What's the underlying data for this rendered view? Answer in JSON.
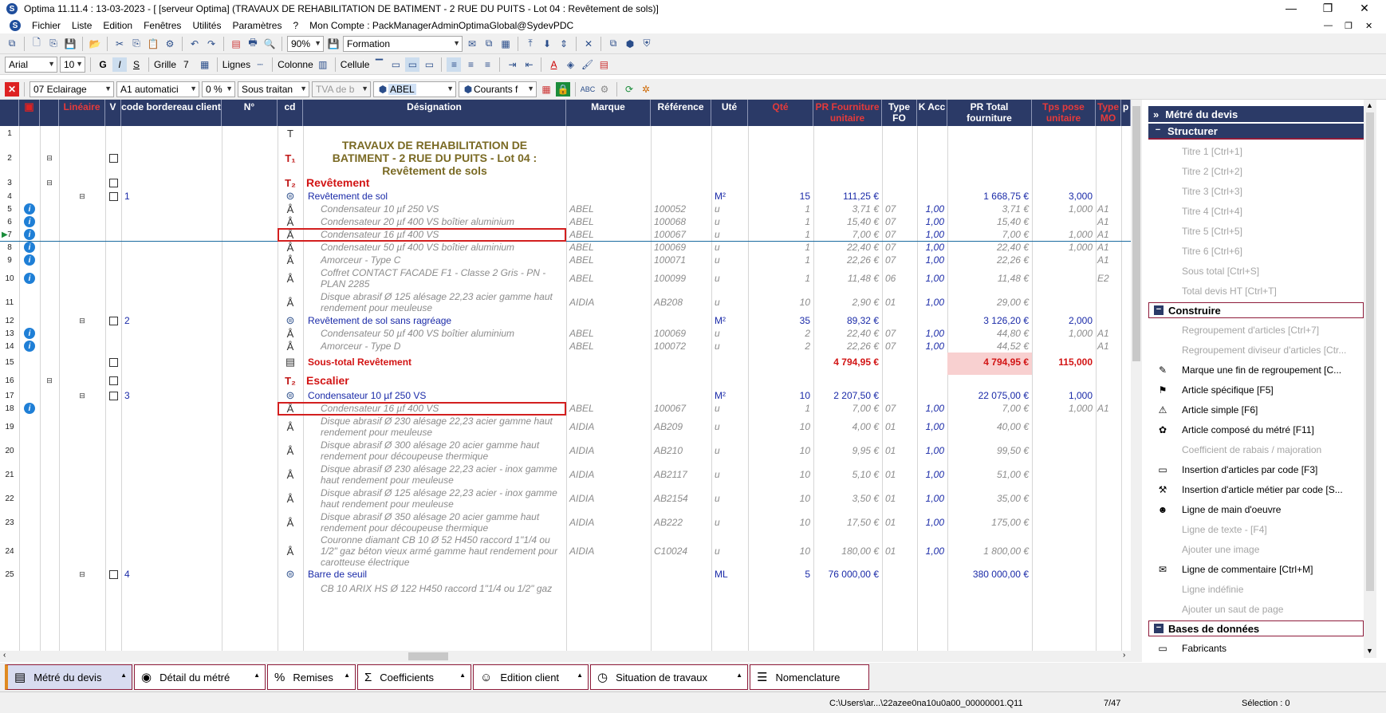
{
  "window": {
    "title": "Optima 11.11.4 : 13-03-2023 - [ [serveur Optima] (TRAVAUX DE REHABILITATION DE BATIMENT - 2 RUE DU PUITS - Lot 04 : Revêtement de sols)]",
    "minimize": "—",
    "restore": "❐",
    "close": "✕"
  },
  "menu": [
    "Fichier",
    "Liste",
    "Edition",
    "Fenêtres",
    "Utilités",
    "Paramètres",
    "?",
    "Mon Compte : PackManagerAdminOptimaGlobal@SydevPDC"
  ],
  "menu_right": [
    "—",
    "❐",
    "✕"
  ],
  "toolbar1": {
    "zoom": "90%",
    "formation": "Formation"
  },
  "toolbar2": {
    "font": "Arial",
    "size": "10",
    "bold": "G",
    "italic": "I",
    "strike": "S",
    "grille": "Grille",
    "grille_val": "7",
    "lignes": "Lignes",
    "colonne": "Colonne",
    "cellule": "Cellule"
  },
  "toolbar3": {
    "lot": "07  Eclairage",
    "mode": "A1  automatici",
    "pct": "0 %",
    "sous": "Sous traitan",
    "tva": "TVA de b",
    "fab": "ABEL",
    "cours": "Courants f"
  },
  "headers": [
    "",
    "",
    "Linéaire",
    "V",
    "code bordereau client",
    "N°",
    "cd",
    "Désignation",
    "Marque",
    "Référence",
    "Uté",
    "Qté",
    "PR Fourniture unitaire",
    "Type FO",
    "K Acc",
    "PR Total fourniture",
    "Tps pose unitaire",
    "Type MO",
    "p"
  ],
  "rows": [
    {
      "n": "1",
      "cd": "T",
      "des": "",
      "style": "plain"
    },
    {
      "n": "2",
      "cd": "T1",
      "des": "TRAVAUX DE REHABILITATION DE BATIMENT - 2 RUE DU PUITS  - Lot 04 : Revêtement de sols",
      "style": "bigtitle",
      "chk": true,
      "tree": "⊟"
    },
    {
      "n": "3",
      "cd": "T2",
      "des": "Revêtement",
      "style": "title",
      "chk": true,
      "tree": "⊟"
    },
    {
      "n": "4",
      "num": "1",
      "cd": "C",
      "des": "Revêtement de sol",
      "style": "comp",
      "ute": "M²",
      "qte": "15",
      "pru": "111,25 €",
      "prt": "1 668,75 €",
      "tps": "3,000",
      "chk": true,
      "tree": "⊟"
    },
    {
      "n": "5",
      "cd": "A",
      "des": "Condensateur 10 µf 250 VS",
      "style": "sub",
      "info": true,
      "marque": "ABEL",
      "ref": "100052",
      "ute": "u",
      "qte": "1",
      "pru": "3,71 €",
      "tfo": "07",
      "kacc": "1,00",
      "prt": "3,71 €",
      "tps": "1,000",
      "tmo": "A1"
    },
    {
      "n": "6",
      "cd": "A",
      "des": "Condensateur 20 µf 400 VS boîtier aluminium",
      "style": "sub",
      "info": true,
      "marque": "ABEL",
      "ref": "100068",
      "ute": "u",
      "qte": "1",
      "pru": "15,40 €",
      "tfo": "07",
      "kacc": "1,00",
      "prt": "15,40 €",
      "tps": "",
      "tmo": "A1"
    },
    {
      "n": "7",
      "cd": "A",
      "des": "Condensateur 16 µf 400 VS",
      "style": "sub",
      "info": true,
      "cur": true,
      "hl": true,
      "marque": "ABEL",
      "ref": "100067",
      "ute": "u",
      "qte": "1",
      "pru": "7,00 €",
      "tfo": "07",
      "kacc": "1,00",
      "prt": "7,00 €",
      "tps": "1,000",
      "tmo": "A1"
    },
    {
      "n": "8",
      "cd": "A",
      "des": "Condensateur 50 µf 400 VS boîtier aluminium",
      "style": "sub",
      "info": true,
      "marque": "ABEL",
      "ref": "100069",
      "ute": "u",
      "qte": "1",
      "pru": "22,40 €",
      "tfo": "07",
      "kacc": "1,00",
      "prt": "22,40 €",
      "tps": "1,000",
      "tmo": "A1"
    },
    {
      "n": "9",
      "cd": "A",
      "des": "Amorceur  - Type C",
      "style": "sub",
      "info": true,
      "marque": "ABEL",
      "ref": "100071",
      "ute": "u",
      "qte": "1",
      "pru": "22,26 €",
      "tfo": "07",
      "kacc": "1,00",
      "prt": "22,26 €",
      "tps": "",
      "tmo": "A1"
    },
    {
      "n": "10",
      "cd": "A",
      "des": "Coffret CONTACT FACADE F1 - Classe 2 Gris - PN - PLAN 2285",
      "style": "sub",
      "info": true,
      "marque": "ABEL",
      "ref": "100099",
      "ute": "u",
      "qte": "1",
      "pru": "11,48 €",
      "tfo": "06",
      "kacc": "1,00",
      "prt": "11,48 €",
      "tps": "",
      "tmo": "E2"
    },
    {
      "n": "11",
      "cd": "A",
      "des": "Disque abrasif Ø 125 alésage 22,23 acier gamme haut rendement pour meuleuse",
      "style": "sub",
      "marque": "AIDIA",
      "ref": "AB208",
      "ute": "u",
      "qte": "10",
      "pru": "2,90 €",
      "tfo": "01",
      "kacc": "1,00",
      "prt": "29,00 €",
      "tps": "",
      "tmo": ""
    },
    {
      "n": "12",
      "num": "2",
      "cd": "C",
      "des": "Revêtement de sol sans ragréage",
      "style": "comp",
      "ute": "M²",
      "qte": "35",
      "pru": "89,32 €",
      "prt": "3 126,20 €",
      "tps": "2,000",
      "chk": true,
      "tree": "⊟"
    },
    {
      "n": "13",
      "cd": "A",
      "des": "Condensateur 50 µf 400 VS boîtier aluminium",
      "style": "sub",
      "info": true,
      "marque": "ABEL",
      "ref": "100069",
      "ute": "u",
      "qte": "2",
      "pru": "22,40 €",
      "tfo": "07",
      "kacc": "1,00",
      "prt": "44,80 €",
      "tps": "1,000",
      "tmo": "A1"
    },
    {
      "n": "14",
      "cd": "A",
      "des": "Amorceur  - Type D",
      "style": "sub",
      "info": true,
      "marque": "ABEL",
      "ref": "100072",
      "ute": "u",
      "qte": "2",
      "pru": "22,26 €",
      "tfo": "07",
      "kacc": "1,00",
      "prt": "44,52 €",
      "tps": "",
      "tmo": "A1"
    },
    {
      "n": "15",
      "cd": "S",
      "des": "Sous-total Revêtement",
      "style": "subtotal",
      "pru": "4 794,95 €",
      "prt": "4 794,95 €",
      "tps": "115,000",
      "chk": true
    },
    {
      "n": "16",
      "cd": "T2",
      "des": "Escalier",
      "style": "title",
      "chk": true,
      "tree": "⊟"
    },
    {
      "n": "17",
      "num": "3",
      "cd": "C",
      "des": "Condensateur 10 µf 250 VS",
      "style": "comp",
      "ute": "M²",
      "qte": "10",
      "pru": "2 207,50 €",
      "prt": "22 075,00 €",
      "tps": "1,000",
      "chk": true,
      "tree": "⊟"
    },
    {
      "n": "18",
      "cd": "A",
      "des": "Condensateur 16 µf 400 VS",
      "style": "sub",
      "info": true,
      "hl": true,
      "marque": "ABEL",
      "ref": "100067",
      "ute": "u",
      "qte": "1",
      "pru": "7,00 €",
      "tfo": "07",
      "kacc": "1,00",
      "prt": "7,00 €",
      "tps": "1,000",
      "tmo": "A1"
    },
    {
      "n": "19",
      "cd": "A",
      "des": "Disque abrasif Ø 230 alésage 22,23 acier gamme haut rendement pour meuleuse",
      "style": "sub",
      "marque": "AIDIA",
      "ref": "AB209",
      "ute": "u",
      "qte": "10",
      "pru": "4,00 €",
      "tfo": "01",
      "kacc": "1,00",
      "prt": "40,00 €",
      "tps": "",
      "tmo": ""
    },
    {
      "n": "20",
      "cd": "A",
      "des": "Disque abrasif Ø 300 alésage 20 acier gamme haut rendement pour découpeuse thermique",
      "style": "sub",
      "marque": "AIDIA",
      "ref": "AB210",
      "ute": "u",
      "qte": "10",
      "pru": "9,95 €",
      "tfo": "01",
      "kacc": "1,00",
      "prt": "99,50 €",
      "tps": "",
      "tmo": ""
    },
    {
      "n": "21",
      "cd": "A",
      "des": "Disque abrasif Ø 230 alésage 22,23 acier - inox gamme haut rendement pour meuleuse",
      "style": "sub",
      "marque": "AIDIA",
      "ref": "AB2117",
      "ute": "u",
      "qte": "10",
      "pru": "5,10 €",
      "tfo": "01",
      "kacc": "1,00",
      "prt": "51,00 €",
      "tps": "",
      "tmo": ""
    },
    {
      "n": "22",
      "cd": "A",
      "des": "Disque abrasif Ø 125 alésage 22,23 acier - inox gamme haut rendement pour meuleuse",
      "style": "sub",
      "marque": "AIDIA",
      "ref": "AB2154",
      "ute": "u",
      "qte": "10",
      "pru": "3,50 €",
      "tfo": "01",
      "kacc": "1,00",
      "prt": "35,00 €",
      "tps": "",
      "tmo": ""
    },
    {
      "n": "23",
      "cd": "A",
      "des": "Disque abrasif Ø 350 alésage 20 acier gamme haut rendement pour découpeuse thermique",
      "style": "sub",
      "marque": "AIDIA",
      "ref": "AB222",
      "ute": "u",
      "qte": "10",
      "pru": "17,50 €",
      "tfo": "01",
      "kacc": "1,00",
      "prt": "175,00 €",
      "tps": "",
      "tmo": ""
    },
    {
      "n": "24",
      "cd": "A",
      "des": "Couronne diamant CB 10 Ø 52 H450 raccord 1\"1/4 ou 1/2\" gaz béton vieux armé gamme haut rendement pour carotteuse électrique",
      "style": "sub",
      "marque": "AIDIA",
      "ref": "C10024",
      "ute": "u",
      "qte": "10",
      "pru": "180,00 €",
      "tfo": "01",
      "kacc": "1,00",
      "prt": "1 800,00 €",
      "tps": "",
      "tmo": ""
    },
    {
      "n": "25",
      "num": "4",
      "cd": "C",
      "des": "Barre de seuil",
      "style": "comp",
      "ute": "ML",
      "qte": "5",
      "pru": "76 000,00 €",
      "prt": "380 000,00 €",
      "tps": "",
      "chk": true,
      "tree": "⊟"
    },
    {
      "n": "",
      "cd": "",
      "des": "CB 10 ARIX HS Ø 122 H450 raccord 1\"1/4 ou 1/2\" gaz",
      "style": "sub"
    }
  ],
  "panel": {
    "header": "Métré du devis",
    "sections": [
      {
        "title": "Structurer",
        "kind": "blue",
        "items": [
          {
            "label": "Titre 1 [Ctrl+1]",
            "dis": true
          },
          {
            "label": "Titre 2 [Ctrl+2]",
            "dis": true
          },
          {
            "label": "Titre 3 [Ctrl+3]",
            "dis": true
          },
          {
            "label": "Titre 4 [Ctrl+4]",
            "dis": true
          },
          {
            "label": "Titre 5 [Ctrl+5]",
            "dis": true
          },
          {
            "label": "Titre 6 [Ctrl+6]",
            "dis": true
          },
          {
            "label": "Sous total [Ctrl+S]",
            "dis": true
          },
          {
            "label": "Total devis HT [Ctrl+T]",
            "dis": true
          }
        ]
      },
      {
        "title": "Construire",
        "kind": "white",
        "items": [
          {
            "label": "Regroupement d'articles  [Ctrl+7]",
            "dis": true
          },
          {
            "label": "Regroupement diviseur d'articles [Ctr...",
            "dis": true
          },
          {
            "label": "Marque une fin de regroupement  [C...",
            "dis": false,
            "ico": "✎"
          },
          {
            "label": "Article spécifique [F5]",
            "dis": false,
            "ico": "⚑"
          },
          {
            "label": "Article simple [F6]",
            "dis": false,
            "ico": "⚠"
          },
          {
            "label": "Article composé du métré [F11]",
            "dis": false,
            "ico": "✿"
          },
          {
            "label": "Coefficient de rabais / majoration",
            "dis": true
          },
          {
            "label": "Insertion d'articles par code [F3]",
            "dis": false,
            "ico": "▭"
          },
          {
            "label": "Insertion d'article métier par code [S...",
            "dis": false,
            "ico": "⚒"
          },
          {
            "label": "Ligne de main d'oeuvre",
            "dis": false,
            "ico": "☻"
          },
          {
            "label": "Ligne de texte - [F4]",
            "dis": true
          },
          {
            "label": "Ajouter une image",
            "dis": true
          },
          {
            "label": "Ligne de commentaire [Ctrl+M]",
            "dis": false,
            "ico": "✉"
          },
          {
            "label": "Ligne indéfinie",
            "dis": true
          },
          {
            "label": "Ajouter un saut de page",
            "dis": true
          }
        ]
      },
      {
        "title": "Bases de données",
        "kind": "white",
        "items": [
          {
            "label": "Fabricants",
            "dis": false,
            "ico": "▭"
          }
        ]
      }
    ]
  },
  "tabs": [
    {
      "label": "Métré du devis",
      "ico": "▤",
      "active": true
    },
    {
      "label": "Détail du métré",
      "ico": "◉"
    },
    {
      "label": "Remises",
      "ico": "%"
    },
    {
      "label": "Coefficients",
      "ico": "Σ"
    },
    {
      "label": "Edition client",
      "ico": "☺"
    },
    {
      "label": "Situation de travaux",
      "ico": "◷"
    },
    {
      "label": "Nomenclature",
      "ico": "☰"
    }
  ],
  "status": {
    "path": "C:\\Users\\ar...\\22azee0na10u0a00_00000001.Q11",
    "pos": "7/47",
    "sel": "Sélection : 0"
  }
}
